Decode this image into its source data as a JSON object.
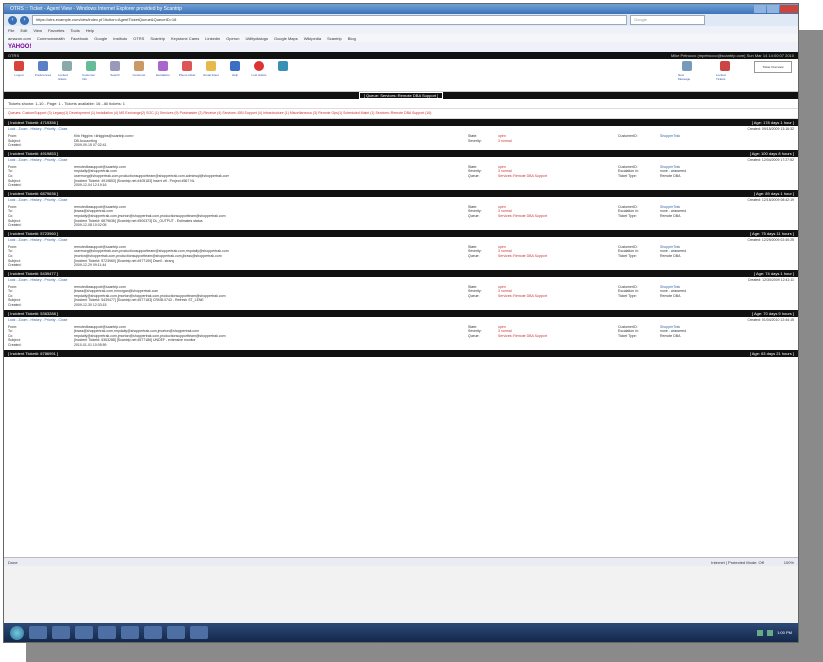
{
  "window": {
    "title": "OTRS :: Ticket - Agent View - Windows Internet Explorer provided by Scantrip"
  },
  "browser": {
    "url": "https://otrs.example.com/otrs/index.pl?Action=AgentTicketQueue&QueueID=18",
    "search_placeholder": "Google",
    "menu": [
      "File",
      "Edit",
      "View",
      "Favorites",
      "Tools",
      "Help"
    ],
    "favorites": [
      "amazon.com",
      "Commonwealth",
      "Facebook",
      "Google",
      "Instituto",
      "OTRS",
      "Scantrip",
      "Keystone Cams",
      "Linkedin",
      "Operon",
      "Utilitydialogs",
      "Google Maps",
      "Wikipedia",
      "Scantrip",
      "Blog"
    ],
    "yahoo_label": "YAHOO!",
    "zoom": "100%"
  },
  "app": {
    "logo": "OTRS",
    "user_info": "Mike Petrucco (mpetrucco@scantrip.com) Sun Mar 14 14:00:07 2010",
    "toolbar": [
      "Logout",
      "Preferences",
      "Locked tickets",
      "Customer Info",
      "Search",
      "Customer",
      "Escalation",
      "Phone ticket",
      "Email ticket",
      "Help",
      "Lost tickets"
    ],
    "toolbar_right": [
      "New Message",
      "Locked Tickets"
    ],
    "ticket_view_label": "Ticket Overview",
    "queue_title": "[ Queue: Services::Remote DBA Support ]",
    "shown_text": "Tickets shown: 1-10 - Page: 1 - Tickets available: 16 - All tickets: 1",
    "filter_text": "Queues: CustomSupport (3)   Legacy(1)   Development (1)   Installation (4)   MS Exchange(2)   SOC (1)   Services (9)   Postmaster (2)   Receive (4)   Services::DBI   Support (4)   Infrastructure (1)   Miscellaneous (3)   Remote Ops(1)   Scheduled Maint (1)   Services::Remote DBA Support (16)"
  },
  "tickets": [
    {
      "number": "[ Incident Ticket#: 4719356 ]",
      "age": "[ Age: 178 days 1 hour ]",
      "created_right": "Created: 09/15/2009 13:16:32",
      "links": "Lock - Zoom - History - Priority - Close",
      "fields": [
        [
          "From:",
          "Kirk Higgins <khiggins@scantrip.com>"
        ],
        [
          "Subject:",
          "DB Accounting"
        ],
        [
          "Created:",
          "2009-09-15 07:32:41"
        ]
      ],
      "state": "open",
      "severity": "3 normal",
      "queue": "",
      "customer_id": "ShopperTrak",
      "escalation": "",
      "ticket_type": ""
    },
    {
      "number": "[ Incident Ticket#: 4919853 ]",
      "age": "[ Age: 100 days 8 hours ]",
      "created_right": "Created: 12/04/2009 17:27:52",
      "links": "Lock - Zoom - History - Priority - Close",
      "fields": [
        [
          "From:",
          "remotedbasupport@scantrip.com"
        ],
        [
          "To:",
          "rmpdaily@shoppertrak.com"
        ],
        [
          "Cc:",
          "usermorg@shoppertrak.com,productionsupportteam@shoppertrak.com,adminsql@shoppertrak.com"
        ],
        [
          "Subject:",
          "[Incident Ticket#: 4919853] [Scantrip.net #405183] Insert off - Project #567 NL"
        ],
        [
          "Created:",
          "2009-12-04 12:19:16"
        ]
      ],
      "state": "open",
      "severity": "3 normal",
      "queue": "Services::Remote DBA Support",
      "customer_id": "ShopperTrak",
      "escalation": "none - answered",
      "ticket_type": "Remote DBA"
    },
    {
      "number": "[ Incident Ticket#: 6879636 ]",
      "age": "[ Age: 89 days 1 hour ]",
      "created_right": "Created: 12/15/2009 08:42:19",
      "links": "Lock - Zoom - History - Priority - Close",
      "fields": [
        [
          "From:",
          "remotedbasupport@scantrip.com"
        ],
        [
          "To:",
          "jbrass@shoppertrak.com"
        ],
        [
          "Cc:",
          "rmpdaily@shoppertrak.com,jmorton@shoppertrak.com,productionsupportteam@shoppertrak.com"
        ],
        [
          "Subject:",
          "[Incident Ticket#: 6879636] [Scantrip.net #500373] DL_OUTPUT - Estimates status"
        ],
        [
          "Created:",
          "2009-12-08 10:02:05"
        ]
      ],
      "state": "open",
      "severity": "3 normal",
      "queue": "Services::Remote DBA Support",
      "customer_id": "ShopperTrak",
      "escalation": "none - answered",
      "ticket_type": "Remote DBA"
    },
    {
      "number": "[ Incident Ticket#: 5723960 ]",
      "age": "[ Age: 75 days 11 hours ]",
      "created_right": "Created: 12/29/2009 02:40:25",
      "links": "Lock - Zoom - History - Priority - Close",
      "fields": [
        [
          "From:",
          "remotedbasupport@scantrip.com"
        ],
        [
          "To:",
          "usermorg@shoppertrak.com,productionsupportteam@shoppertrak.com,rmpdaily@shoppertrak.com"
        ],
        [
          "Cc:",
          "jmorton@shoppertrak.com,productionsupportteam@shoppertrak.com,jbrass@shoppertrak.com"
        ],
        [
          "Subject:",
          "[Incident Ticket#: 5723960] [Scantrip.net #577190] Dwell - strang"
        ],
        [
          "Created:",
          "2009-12-29 09:11:44"
        ]
      ],
      "state": "open",
      "severity": "3 normal",
      "queue": "Services::Remote DBA Support",
      "customer_id": "ShopperTrak",
      "escalation": "none - answered",
      "ticket_type": "Remote DBA"
    },
    {
      "number": "[ Incident Ticket#: 5439477 ]",
      "age": "[ Age: 74 days 1 hour ]",
      "created_right": "Created: 12/30/2009 12:41:11",
      "links": "Lock - Zoom - History - Priority - Close",
      "fields": [
        [
          "From:",
          "remotedbasupport@scantrip.com"
        ],
        [
          "To:",
          "jbrass@shoppertrak.com,mmorgan@shoppertrak.com"
        ],
        [
          "Cc:",
          "rmpdaily@shoppertrak.com,jmorton@shoppertrak.com,productionsupportteam@shoppertrak.com"
        ],
        [
          "Subject:",
          "[Incident Ticket#: 5439477] [Scantrip.net #577183] CRNB-0743 - Refresh ST_LENE"
        ],
        [
          "Created:",
          "2009-12-30 12:33:15"
        ]
      ],
      "state": "open",
      "severity": "3 normal",
      "queue": "Services::Remote DBA Support",
      "customer_id": "ShopperTrak",
      "escalation": "none - answered",
      "ticket_type": "Remote DBA"
    },
    {
      "number": "[ Incident Ticket#: 5363288 ]",
      "age": "[ Age: 70 days 9 hours ]",
      "created_right": "Created: 01/04/2010 12:44:15",
      "links": "Lock - Zoom - History - Priority - Close",
      "fields": [
        [
          "From:",
          "remotedbasupport@scantrip.com"
        ],
        [
          "To:",
          "jbrass@shoppertrak.com,rmpdaily@shoppertrak.com,jmorton@shoppertrak.com"
        ],
        [
          "Cc:",
          "rmpdaily@shoppertrak.com,jmorton@shoppertrak.com,productionsupportteam@shoppertrak.com"
        ],
        [
          "Subject:",
          "[Incident Ticket#: 5363288] [Scantrip.net #577186] UNDEF - extensive monitor"
        ],
        [
          "Created:",
          "2010-01-01 10:05:59"
        ]
      ],
      "state": "open",
      "severity": "3 normal",
      "queue": "Services::Remote DBA Support",
      "customer_id": "ShopperTrak",
      "escalation": "none - answered",
      "ticket_type": "Remote DBA"
    }
  ],
  "last_ticket_header": {
    "number": "[ Incident Ticket#: 6786991 ]",
    "age": "[ Age: 63 days 21 hours ]"
  },
  "labels": {
    "state": "State:",
    "severity": "Severity:",
    "queue": "Queue:",
    "customer_id": "CustomerID:",
    "escalation": "Escalation in:",
    "ticket_type": "Ticket Type:"
  },
  "statusbar": {
    "left": "Done",
    "zone": "Internet | Protected Mode: Off",
    "zoom": "100%"
  },
  "taskbar": {
    "clock": "1:00 PM"
  },
  "colors": {
    "header_black": "#111111",
    "link_blue": "#3366aa",
    "state_red": "#cc3333"
  }
}
